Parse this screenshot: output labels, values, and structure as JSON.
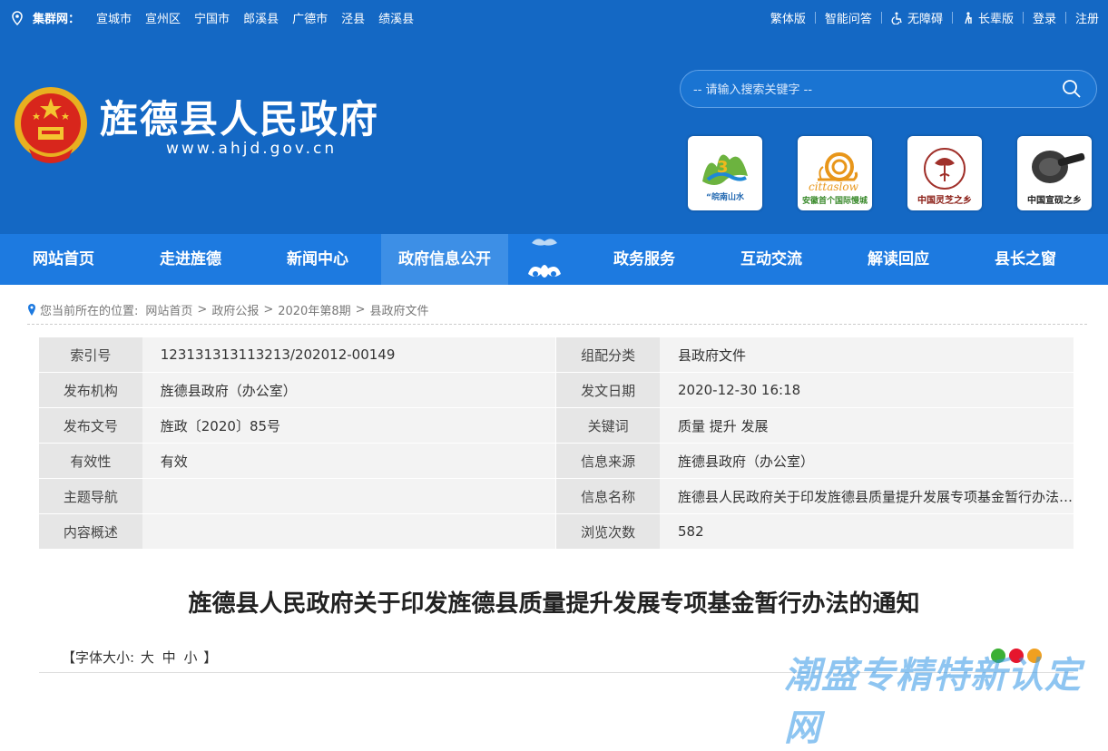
{
  "topbar": {
    "cluster_label": "集群网：",
    "cities": [
      "宣城市",
      "宣州区",
      "宁国市",
      "郎溪县",
      "广德市",
      "泾县",
      "绩溪县"
    ],
    "links": [
      {
        "label": "繁体版",
        "icon": ""
      },
      {
        "label": "智能问答",
        "icon": ""
      },
      {
        "label": "无障碍",
        "icon": "wheelchair-icon"
      },
      {
        "label": "长辈版",
        "icon": "elder-icon"
      },
      {
        "label": "登录",
        "icon": ""
      },
      {
        "label": "注册",
        "icon": ""
      }
    ]
  },
  "header": {
    "title": "旌德县人民政府",
    "url": "www.ahjd.gov.cn",
    "search_placeholder": "-- 请输入搜索关键字 --",
    "badges": [
      {
        "caption": "“皖南山水"
      },
      {
        "caption": "安徽首个国际慢城"
      },
      {
        "caption": "中国灵芝之乡"
      },
      {
        "caption": "中国宣砚之乡"
      }
    ],
    "badge2_word": "cittaslow"
  },
  "nav": {
    "items": [
      "网站首页",
      "走进旌德",
      "新闻中心",
      "政府信息公开",
      "政务服务",
      "互动交流",
      "解读回应",
      "县长之窗"
    ],
    "active": "政府信息公开"
  },
  "breadcrumb": {
    "prefix": "您当前所在的位置:",
    "items": [
      "网站首页",
      "政府公报",
      "2020年第8期",
      "县政府文件"
    ]
  },
  "info_rows": [
    {
      "k1": "索引号",
      "v1": "123131313113213/202012-00149",
      "k2": "组配分类",
      "v2": "县政府文件"
    },
    {
      "k1": "发布机构",
      "v1": "旌德县政府（办公室）",
      "k2": "发文日期",
      "v2": "2020-12-30 16:18"
    },
    {
      "k1": "发布文号",
      "v1": "旌政〔2020〕85号",
      "k2": "关键词",
      "v2": "质量 提升 发展"
    },
    {
      "k1": "有效性",
      "v1": "有效",
      "k2": "信息来源",
      "v2": "旌德县政府（办公室）"
    },
    {
      "k1": "主题导航",
      "v1": "",
      "k2": "信息名称",
      "v2": "旌德县人民政府关于印发旌德县质量提升发展专项基金暂行办法的通知"
    },
    {
      "k1": "内容概述",
      "v1": "",
      "k2": "浏览次数",
      "v2": "582"
    }
  ],
  "document": {
    "title": "旌德县人民政府关于印发旌德县质量提升发展专项基金暂行办法的通知",
    "font_size_prefix": "【字体大小:",
    "font_sizes": [
      "大",
      "中",
      "小"
    ],
    "font_size_suffix": "】"
  },
  "watermark": "潮盛专精特新认定网",
  "colors": {
    "header_bg": "#1468c4",
    "nav_bg": "#1d7ae0",
    "nav_active": "#3d8fe6"
  }
}
